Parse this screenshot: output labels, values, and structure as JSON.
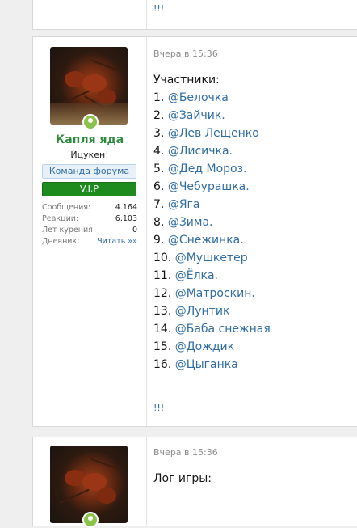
{
  "top_post": {
    "tail": "!!!"
  },
  "main_post": {
    "user": {
      "name": "Капля яда",
      "title": "Йцукен!",
      "banner_team": "Команда форума",
      "banner_vip": "V.I.P",
      "stats": [
        {
          "label": "Сообщения:",
          "value": "4.164"
        },
        {
          "label": "Реакции:",
          "value": "6.103"
        },
        {
          "label": "Лет курения:",
          "value": "0"
        },
        {
          "label": "Дневник:",
          "value": "Читать »»"
        }
      ]
    },
    "date": "Вчера в 15:36",
    "heading": "Участники:",
    "members": [
      {
        "num": "1.",
        "mention": "@Белочка"
      },
      {
        "num": "2.",
        "mention": "@Зайчик."
      },
      {
        "num": "3.",
        "mention": "@Лев Лещенко"
      },
      {
        "num": "4.",
        "mention": "@Лисичка."
      },
      {
        "num": "5.",
        "mention": "@Дед Мороз."
      },
      {
        "num": "6.",
        "mention": "@Чебурашка."
      },
      {
        "num": "7.",
        "mention": "@Яга"
      },
      {
        "num": "8.",
        "mention": "@Зима."
      },
      {
        "num": "9.",
        "mention": "@Снежинка."
      },
      {
        "num": "10.",
        "mention": "@Мушкетер"
      },
      {
        "num": "11.",
        "mention": "@Ёлка."
      },
      {
        "num": "12.",
        "mention": "@Матроскин."
      },
      {
        "num": "13.",
        "mention": "@Лунтик"
      },
      {
        "num": "14.",
        "mention": "@Баба снежная"
      },
      {
        "num": "15.",
        "mention": "@Дождик"
      },
      {
        "num": "16.",
        "mention": "@Цыганка"
      }
    ],
    "tail": "!!!"
  },
  "bottom_post": {
    "date": "Вчера в 15:36",
    "text": "Лог игры:"
  }
}
